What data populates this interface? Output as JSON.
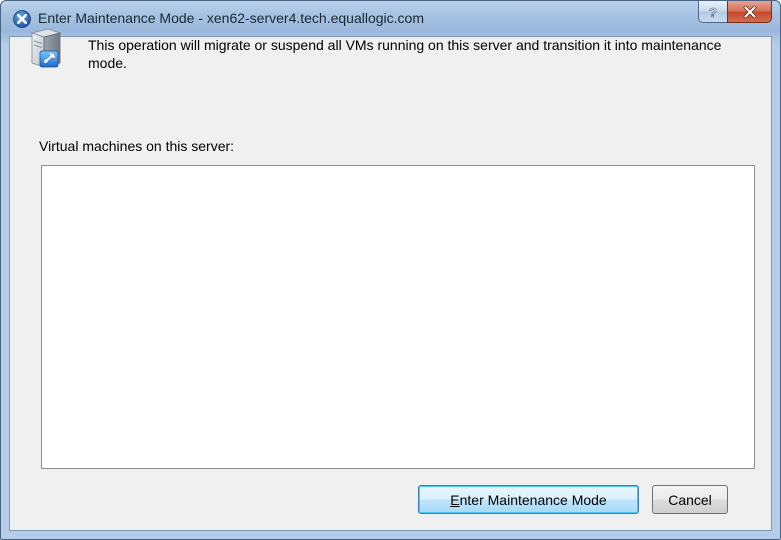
{
  "window": {
    "title": "Enter Maintenance Mode - xen62-server4.tech.equallogic.com",
    "app_icon": "xencenter-icon",
    "help_label": "?",
    "close_label": "X"
  },
  "dialog": {
    "info_icon": "server-maintenance-icon",
    "message": "This operation will migrate or suspend all VMs running on this server and transition it into maintenance mode.",
    "list_label": "Virtual machines on this server:",
    "vm_items": []
  },
  "buttons": {
    "enter_maintenance": "Enter Maintenance Mode",
    "cancel": "Cancel"
  },
  "colors": {
    "title_bar": "#a7c3e2",
    "close_button": "#c7492c",
    "client_background": "#f0f0f0",
    "primary_button_border": "#3c7fb1"
  }
}
